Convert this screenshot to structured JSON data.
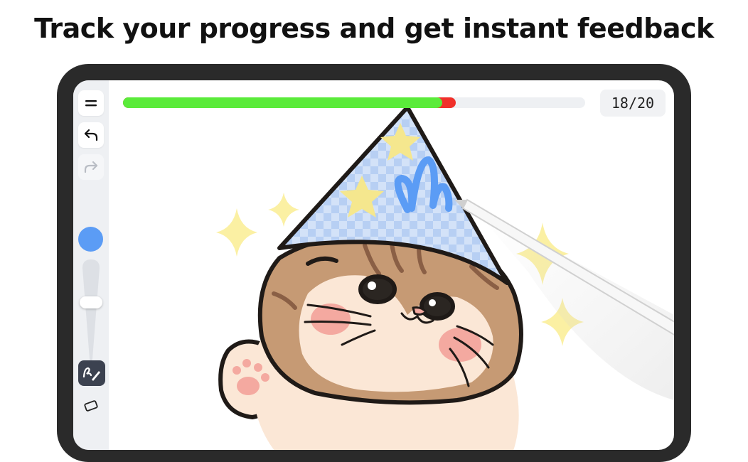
{
  "headline": "Track your progress and get instant feedback",
  "progress": {
    "counter": "18/20",
    "correct_fraction": 0.69,
    "attempted_fraction": 0.72,
    "correct_color": "#5aeb3a",
    "wrong_color": "#f0302a"
  },
  "toolbar": {
    "menu_icon": "menu-icon",
    "undo_icon": "undo-icon",
    "redo_icon": "redo-icon",
    "redo_enabled": false,
    "active_color": "#5b9cf5",
    "brush_size_fraction": 0.6,
    "pen_icon": "pen-icon",
    "eraser_icon": "eraser-icon"
  },
  "artwork": {
    "subject": "cat-with-party-hat-icon",
    "stylus": "stylus-icon"
  }
}
